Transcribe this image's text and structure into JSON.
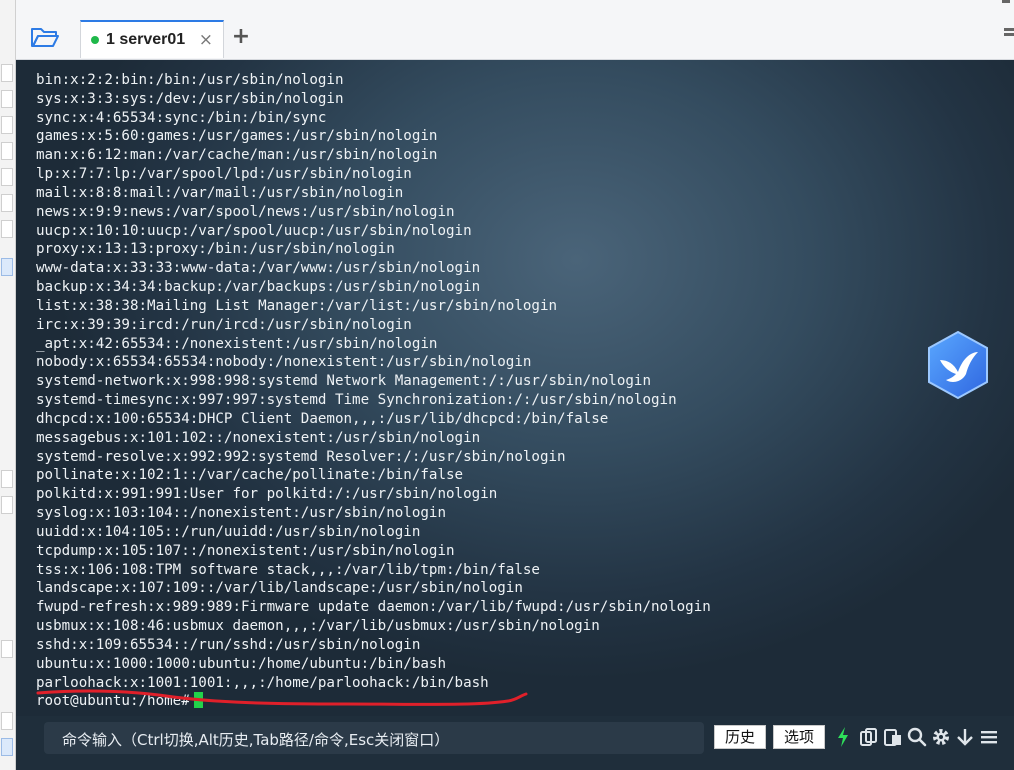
{
  "tab": {
    "label": "1 server01",
    "close": "×",
    "status_color": "#1fb84a"
  },
  "add_tab": "+",
  "terminal": {
    "lines": [
      "bin:x:2:2:bin:/bin:/usr/sbin/nologin",
      "sys:x:3:3:sys:/dev:/usr/sbin/nologin",
      "sync:x:4:65534:sync:/bin:/bin/sync",
      "games:x:5:60:games:/usr/games:/usr/sbin/nologin",
      "man:x:6:12:man:/var/cache/man:/usr/sbin/nologin",
      "lp:x:7:7:lp:/var/spool/lpd:/usr/sbin/nologin",
      "mail:x:8:8:mail:/var/mail:/usr/sbin/nologin",
      "news:x:9:9:news:/var/spool/news:/usr/sbin/nologin",
      "uucp:x:10:10:uucp:/var/spool/uucp:/usr/sbin/nologin",
      "proxy:x:13:13:proxy:/bin:/usr/sbin/nologin",
      "www-data:x:33:33:www-data:/var/www:/usr/sbin/nologin",
      "backup:x:34:34:backup:/var/backups:/usr/sbin/nologin",
      "list:x:38:38:Mailing List Manager:/var/list:/usr/sbin/nologin",
      "irc:x:39:39:ircd:/run/ircd:/usr/sbin/nologin",
      "_apt:x:42:65534::/nonexistent:/usr/sbin/nologin",
      "nobody:x:65534:65534:nobody:/nonexistent:/usr/sbin/nologin",
      "systemd-network:x:998:998:systemd Network Management:/:/usr/sbin/nologin",
      "systemd-timesync:x:997:997:systemd Time Synchronization:/:/usr/sbin/nologin",
      "dhcpcd:x:100:65534:DHCP Client Daemon,,,:/usr/lib/dhcpcd:/bin/false",
      "messagebus:x:101:102::/nonexistent:/usr/sbin/nologin",
      "systemd-resolve:x:992:992:systemd Resolver:/:/usr/sbin/nologin",
      "pollinate:x:102:1::/var/cache/pollinate:/bin/false",
      "polkitd:x:991:991:User for polkitd:/:/usr/sbin/nologin",
      "syslog:x:103:104::/nonexistent:/usr/sbin/nologin",
      "uuidd:x:104:105::/run/uuidd:/usr/sbin/nologin",
      "tcpdump:x:105:107::/nonexistent:/usr/sbin/nologin",
      "tss:x:106:108:TPM software stack,,,:/var/lib/tpm:/bin/false",
      "landscape:x:107:109::/var/lib/landscape:/usr/sbin/nologin",
      "fwupd-refresh:x:989:989:Firmware update daemon:/var/lib/fwupd:/usr/sbin/nologin",
      "usbmux:x:108:46:usbmux daemon,,,:/var/lib/usbmux:/usr/sbin/nologin",
      "sshd:x:109:65534::/run/sshd:/usr/sbin/nologin",
      "ubuntu:x:1000:1000:ubuntu:/home/ubuntu:/bin/bash",
      "parloohack:x:1001:1001:,,,:/home/parloohack:/bin/bash"
    ],
    "prompt": "root@ubuntu:/home#",
    "cursor_color": "#22d24a",
    "annotation_color": "#e0202a"
  },
  "command_bar": {
    "placeholder": "命令输入（Ctrl切换,Alt历史,Tab路径/命令,Esc关闭窗口）",
    "history_button": "历史",
    "options_button": "选项"
  },
  "tools": [
    "lightning-icon",
    "copy-icon",
    "paste-icon",
    "search-icon",
    "gear-icon",
    "download-icon",
    "menu-icon"
  ]
}
